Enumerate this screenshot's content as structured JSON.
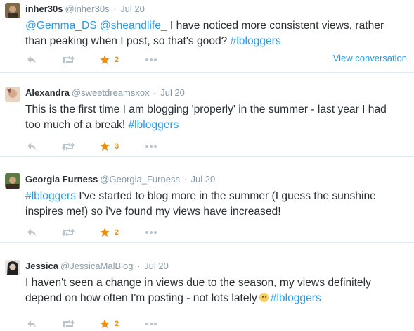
{
  "tweets": [
    {
      "name": "inher30s",
      "handle": "@inher30s",
      "separator": "·",
      "time": "Jul 20",
      "text_lines": [
        [
          {
            "t": "@Gemma_DS",
            "link": true
          },
          {
            "t": " ",
            "link": false
          },
          {
            "t": "@sheandlife_",
            "link": true
          },
          {
            "t": " I have noticed more consistent views, rather",
            "link": false
          }
        ],
        [
          {
            "t": "than peaking when I post, so that's good? ",
            "link": false
          },
          {
            "t": "#lbloggers",
            "link": true
          }
        ]
      ],
      "favorites": "2",
      "view_conversation": "View conversation",
      "avatar_colors": [
        "#6b5a3a",
        "#c9a27a"
      ]
    },
    {
      "name": "Alexandra",
      "handle": "@sweetdreamsxox",
      "separator": "·",
      "time": "Jul 20",
      "text_lines": [
        [
          {
            "t": "This is the first time I am blogging 'properly' in the summer - last year I had",
            "link": false
          }
        ],
        [
          {
            "t": "too much of a break! ",
            "link": false
          },
          {
            "t": "#lbloggers",
            "link": true
          }
        ]
      ],
      "favorites": "3",
      "avatar_colors": [
        "#d9b79a",
        "#8a5a48"
      ]
    },
    {
      "name": "Georgia Furness",
      "handle": "@Georgia_Furness",
      "separator": "·",
      "time": "Jul 20",
      "text_lines": [
        [
          {
            "t": "#lbloggers",
            "link": true
          },
          {
            "t": " I've started to blog more in the summer (I guess the sunshine",
            "link": false
          }
        ],
        [
          {
            "t": "inspires me!) so i've found my views have increased!",
            "link": false
          }
        ]
      ],
      "favorites": "2",
      "avatar_colors": [
        "#4f6a38",
        "#a68b62"
      ]
    },
    {
      "name": "Jessica",
      "handle": "@JessicaMalBlog",
      "separator": "·",
      "time": "Jul 20",
      "text_lines": [
        [
          {
            "t": "I haven't seen a change in views due to the season, my views definitely",
            "link": false
          }
        ],
        [
          {
            "t": "depend on how often I'm posting - not lots lately",
            "link": false
          },
          {
            "emoji": "slightly-smiling-face"
          },
          {
            "t": "#lbloggers",
            "link": true
          }
        ]
      ],
      "favorites": "2",
      "avatar_colors": [
        "#2a2a2a",
        "#d8c9bd"
      ]
    }
  ],
  "icons": {
    "reply": "reply-icon",
    "retweet": "retweet-icon",
    "favorite": "star-icon",
    "more": "more-icon"
  },
  "colors": {
    "link": "#2b9ae6",
    "muted": "#8899a6",
    "favorite": "#f08f0a",
    "text": "#292f33",
    "divider": "#e1e8ed"
  }
}
